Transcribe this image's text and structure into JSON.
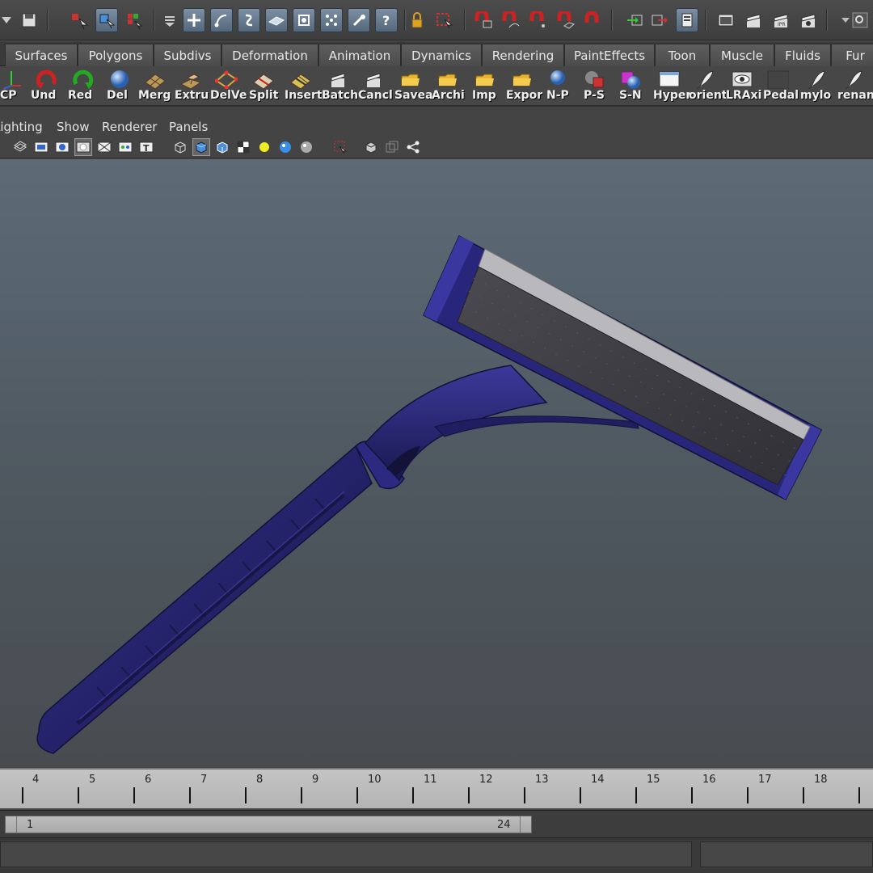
{
  "shelf_tabs": [
    "Surfaces",
    "Polygons",
    "Subdivs",
    "Deformation",
    "Animation",
    "Dynamics",
    "Rendering",
    "PaintEffects",
    "Toon",
    "Muscle",
    "Fluids",
    "Fur"
  ],
  "shelf_buttons": [
    "CP",
    "Und",
    "Red",
    "Del",
    "Merg",
    "Extru",
    "DelVe",
    "Split",
    "Insert",
    "Batch",
    "Cancl",
    "Savea",
    "Archi",
    "Imp",
    "Expor",
    "N-P",
    "P-S",
    "S-N",
    "Hyper",
    "orient",
    "LRAxi",
    "Pedal",
    "mylo",
    "renan"
  ],
  "panel_menu": [
    "Lighting",
    "Show",
    "Renderer",
    "Panels"
  ],
  "time_slider": {
    "labels": [
      "4",
      "5",
      "6",
      "7",
      "8",
      "9",
      "10",
      "11",
      "12",
      "13",
      "14",
      "15",
      "16",
      "17",
      "18"
    ]
  },
  "range_slider": {
    "start": "1",
    "end": "24"
  },
  "colors": {
    "razor_body": "#25236b",
    "razor_highlight": "#3c3a9a",
    "blade": "#3e3e44",
    "blade_edge": "#b9b9bd"
  }
}
